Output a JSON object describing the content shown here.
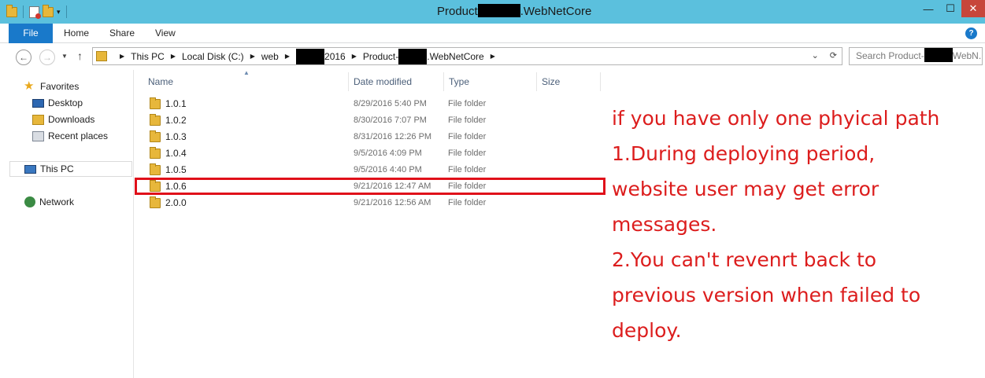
{
  "window": {
    "title_prefix": "Product",
    "title_suffix": ".WebNetCore",
    "minimize": "—",
    "maximize": "☐",
    "close": "✕"
  },
  "ribbon": {
    "file": "File",
    "home": "Home",
    "share": "Share",
    "view": "View",
    "help": "?"
  },
  "address": {
    "this_pc": "This PC",
    "local_disk": "Local Disk (C:)",
    "web": "web",
    "year": "2016",
    "product_prefix": "Product-",
    "product_suffix": ".WebNetCore",
    "search_prefix": "Search Product-",
    "search_suffix": "WebN..."
  },
  "nav": {
    "favorites": "Favorites",
    "desktop": "Desktop",
    "downloads": "Downloads",
    "recent": "Recent places",
    "this_pc": "This PC",
    "network": "Network"
  },
  "columns": {
    "name": "Name",
    "date": "Date modified",
    "type": "Type",
    "size": "Size"
  },
  "files": [
    {
      "name": "1.0.1",
      "date": "8/29/2016 5:40 PM",
      "type": "File folder"
    },
    {
      "name": "1.0.2",
      "date": "8/30/2016 7:07 PM",
      "type": "File folder"
    },
    {
      "name": "1.0.3",
      "date": "8/31/2016 12:26 PM",
      "type": "File folder"
    },
    {
      "name": "1.0.4",
      "date": "9/5/2016 4:09 PM",
      "type": "File folder"
    },
    {
      "name": "1.0.5",
      "date": "9/5/2016 4:40 PM",
      "type": "File folder"
    },
    {
      "name": "1.0.6",
      "date": "9/21/2016 12:47 AM",
      "type": "File folder"
    },
    {
      "name": "2.0.0",
      "date": "9/21/2016 12:56 AM",
      "type": "File folder"
    }
  ],
  "annotation": {
    "line1": "if you have only one phyical path",
    "line2": "1.During deploying period,",
    "line3": "website user may get error",
    "line4": "messages.",
    "line5": "2.You can't revenrt back to",
    "line6": "previous version  when failed to",
    "line7": "deploy."
  },
  "colors": {
    "titlebar": "#5bc0dd",
    "file_tab": "#1979ca",
    "annotation": "#dc1d1d",
    "highlight": "#e0101a"
  }
}
